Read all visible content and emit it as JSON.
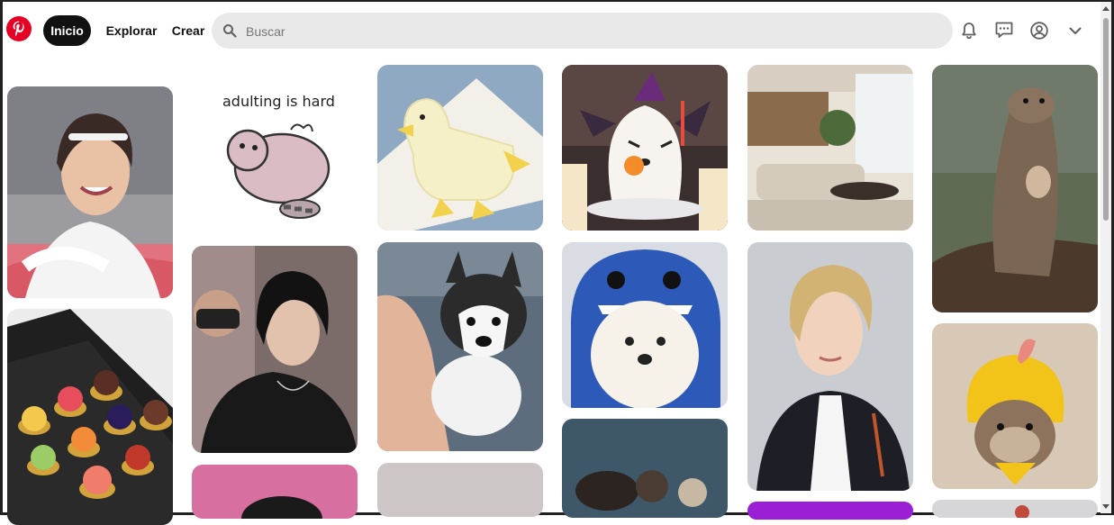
{
  "nav": {
    "home": "Inicio",
    "explore": "Explorar",
    "create": "Crear"
  },
  "search": {
    "placeholder": "Buscar"
  },
  "icons": {
    "logo": "pinterest-logo",
    "notifications": "bell-icon",
    "messages": "chat-icon",
    "profile": "user-circle-icon",
    "menu": "chevron-down-icon",
    "search": "search-icon"
  },
  "colors": {
    "brand": "#e60023",
    "active_pill": "#111111",
    "search_bg": "#e9e9e9"
  },
  "pins": [
    {
      "subject": "smiling young man with white headband"
    },
    {
      "subject": "cartoon of a pink hamster with raccoon tail",
      "sticker_text": "adulting is hard"
    },
    {
      "subject": "duck shaped white cake"
    },
    {
      "subject": "ghost shaped halloween cake with candles"
    },
    {
      "subject": "modern living room interior"
    },
    {
      "subject": "otter standing on a rock"
    },
    {
      "subject": "box of assorted mini tarts"
    },
    {
      "subject": "young man with dark hair in black jacket"
    },
    {
      "subject": "husky puppy held in a hand"
    },
    {
      "subject": "white samoyed dog in blue hoodie"
    },
    {
      "subject": "young man with blond hair in blazer"
    },
    {
      "subject": "otter wearing yellow chick hat"
    },
    {
      "subject": "pink background photo"
    },
    {
      "subject": "grey photo"
    },
    {
      "subject": "otters floating in water"
    },
    {
      "subject": "purple photo"
    },
    {
      "subject": "light grey photo"
    }
  ]
}
